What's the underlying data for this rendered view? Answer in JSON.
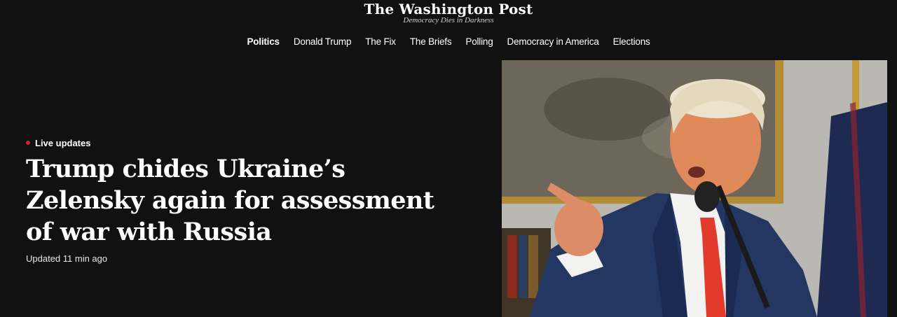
{
  "masthead": {
    "logo": "The Washington Post",
    "tagline": "Democracy Dies in Darkness"
  },
  "nav": {
    "items": [
      {
        "label": "Politics",
        "active": true
      },
      {
        "label": "Donald Trump"
      },
      {
        "label": "The Fix"
      },
      {
        "label": "The Briefs"
      },
      {
        "label": "Polling"
      },
      {
        "label": "Democracy in America"
      },
      {
        "label": "Elections"
      }
    ]
  },
  "story": {
    "kicker": "Live updates",
    "headline": "Trump chides Ukraine’s Zelensky again for assessment of war with Russia",
    "timestamp": "Updated 11 min ago"
  },
  "colors": {
    "background": "#111111",
    "text": "#ffffff",
    "live_dot": "#d8211f"
  }
}
